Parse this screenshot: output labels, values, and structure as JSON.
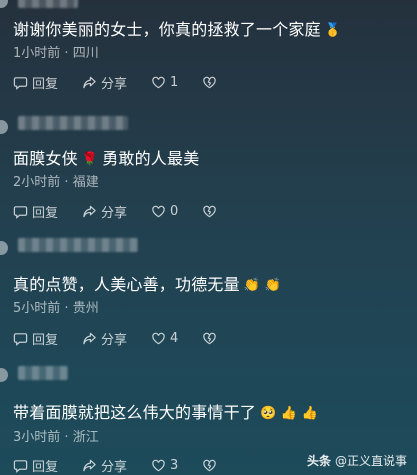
{
  "comments": [
    {
      "text": "谢谢你美丽的女士，你真的拯救了一个家庭",
      "emoji": "🥇",
      "time": "1小时前",
      "separator": "·",
      "location": "四川",
      "reply_label": "回复",
      "share_label": "分享",
      "like_count": "1"
    },
    {
      "text_before": "面膜女侠",
      "emoji": "🌹",
      "text_after": "勇敢的人最美",
      "time": "2小时前",
      "separator": "·",
      "location": "福建",
      "reply_label": "回复",
      "share_label": "分享",
      "like_count": "0"
    },
    {
      "text": "真的点赞，人美心善，功德无量",
      "emoji": "👏 👏",
      "time": "5小时前",
      "separator": "·",
      "location": "贵州",
      "reply_label": "回复",
      "share_label": "分享",
      "like_count": "4"
    },
    {
      "text": "带着面膜就把这么伟大的事情干了",
      "emoji": "🥺 👍 👍",
      "time": "3小时前",
      "separator": "·",
      "location": "浙江",
      "reply_label": "回复",
      "share_label": "分享",
      "like_count": "3"
    }
  ],
  "watermark": {
    "brand": "头条",
    "handle": "@正义直说事"
  }
}
